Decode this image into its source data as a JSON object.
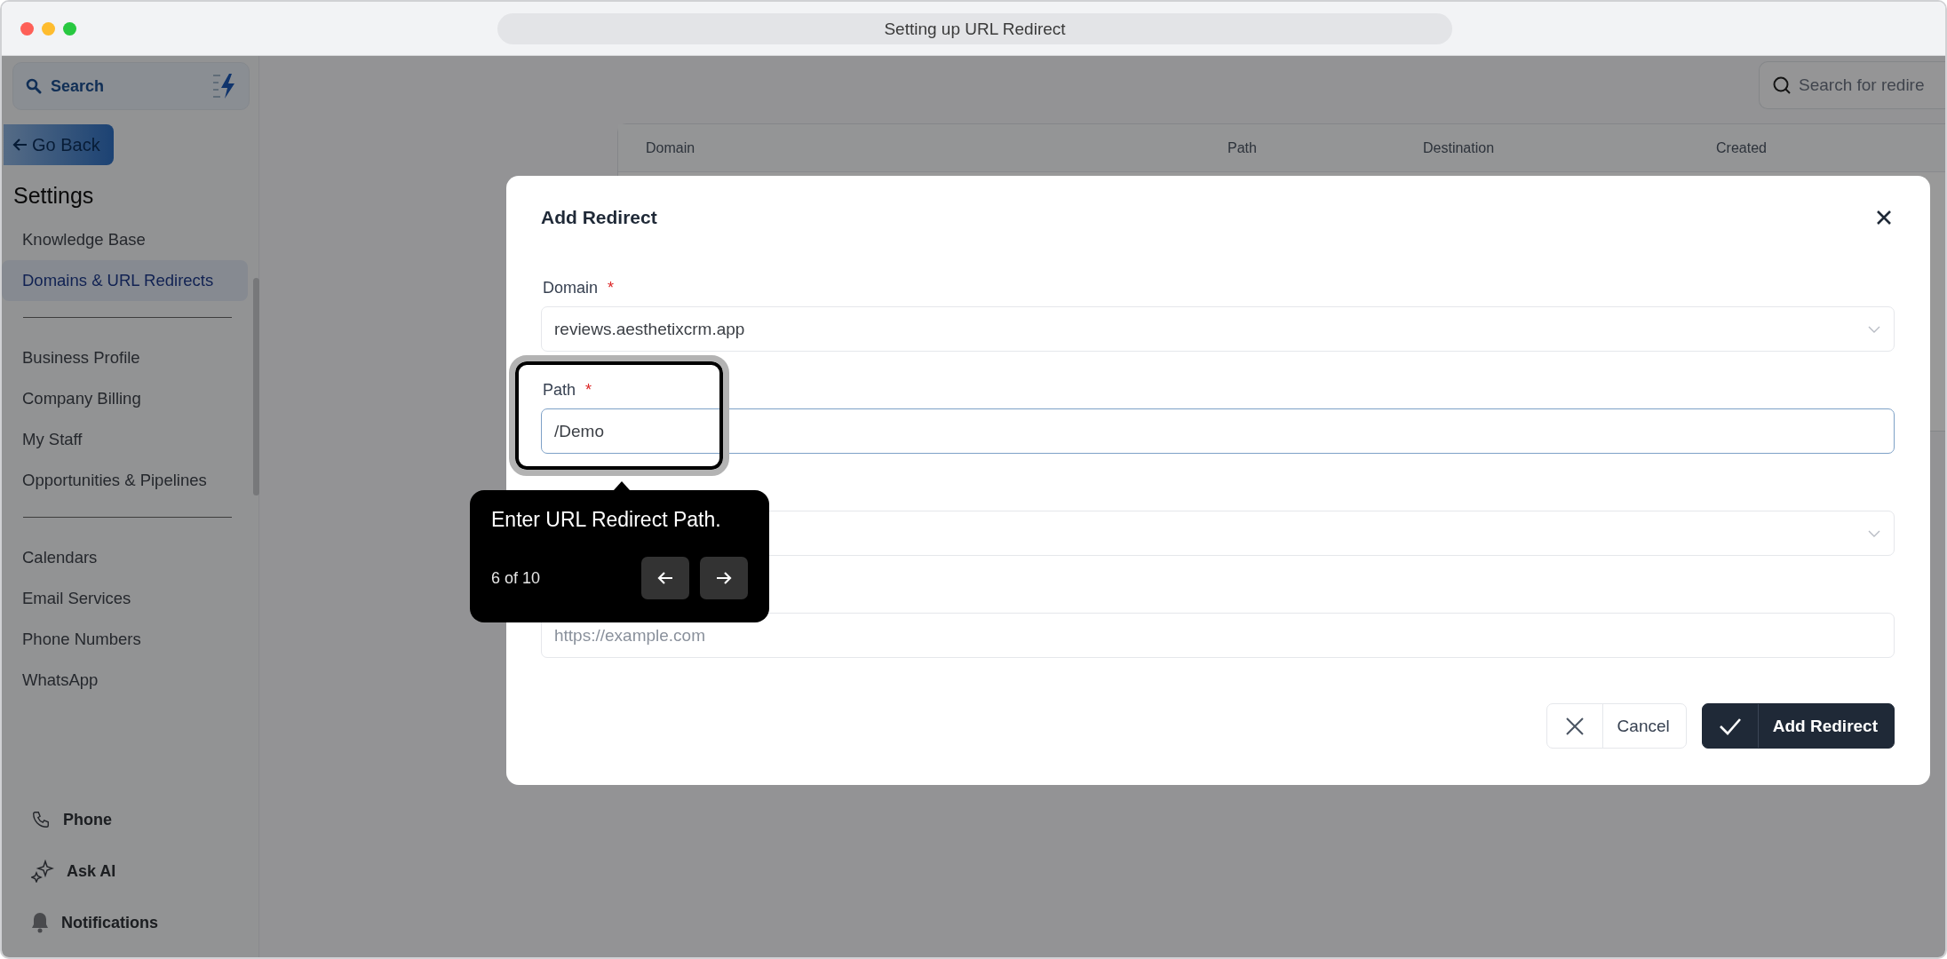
{
  "window": {
    "title": "Setting up URL Redirect"
  },
  "sidebar": {
    "search": {
      "label": "Search"
    },
    "back_button": "Go Back",
    "heading": "Settings",
    "groups": [
      [
        {
          "label": "Knowledge Base",
          "selected": false
        },
        {
          "label": "Domains & URL Redirects",
          "selected": true
        }
      ],
      [
        {
          "label": "Business Profile",
          "selected": false
        },
        {
          "label": "Company Billing",
          "selected": false
        },
        {
          "label": "My Staff",
          "selected": false
        },
        {
          "label": "Opportunities & Pipelines",
          "selected": false
        }
      ],
      [
        {
          "label": "Calendars",
          "selected": false
        },
        {
          "label": "Email Services",
          "selected": false
        },
        {
          "label": "Phone Numbers",
          "selected": false
        },
        {
          "label": "WhatsApp",
          "selected": false
        }
      ]
    ],
    "footer": [
      {
        "label": "Phone",
        "kind": "phone"
      },
      {
        "label": "Ask AI",
        "kind": "ai"
      },
      {
        "label": "Notifications",
        "kind": "bell"
      }
    ]
  },
  "main": {
    "search": {
      "placeholder": "Search for redire"
    },
    "table": {
      "columns": [
        "Domain",
        "Path",
        "Destination",
        "Created"
      ]
    }
  },
  "modal": {
    "title": "Add Redirect",
    "fields": [
      {
        "label": "Domain",
        "required_mark": "*",
        "kind": "select",
        "value": "reviews.aesthetixcrm.app",
        "focused": false,
        "highlighted": false
      },
      {
        "label": "Path",
        "required_mark": "*",
        "kind": "text",
        "value": "/Demo",
        "focused": true,
        "highlighted": true
      },
      {
        "kind": "select",
        "focused": false,
        "highlighted": false
      },
      {
        "kind": "text",
        "placeholder": "https://example.com",
        "focused": false,
        "highlighted": false
      }
    ],
    "buttons": [
      {
        "label": "Cancel",
        "kind": "secondary"
      },
      {
        "label": "Add Redirect",
        "kind": "primary"
      }
    ]
  },
  "tour": {
    "text": "Enter URL Redirect Path.",
    "step": "6 of 10"
  }
}
